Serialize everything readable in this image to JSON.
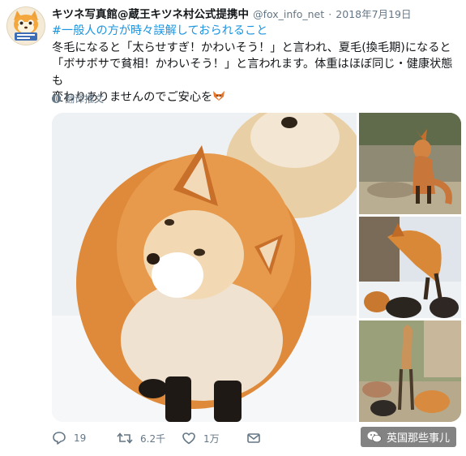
{
  "tweet": {
    "author": {
      "display_name": "キツネ写真館@蔵王キツネ村公式提携中",
      "handle": "@fox_info_net",
      "date": "2018年7月19日"
    },
    "separator": "·",
    "hashtag": "#一般人の方が時々誤解しておられること",
    "text_lines": [
      "冬毛になると「太らせすぎ！かわいそう！」と言われ、夏毛(換毛期)になると",
      "「ボサボサで貧相！かわいそう！」と言われます。体重はほぼ同じ・健康状態も",
      "変わりありませんのでご安心を"
    ],
    "emoji_icon": "fox-emoji",
    "translate_label": "翻译推文",
    "photos": [
      "winter-fox-photo",
      "summer-fox-photo",
      "jumping-fox-photo",
      "fox-group-photo"
    ],
    "actions": {
      "reply_count": "19",
      "retweet_count": "6.2千",
      "like_count": "1万"
    }
  },
  "watermark": {
    "label": "英国那些事儿",
    "icon": "wechat-icon"
  },
  "colors": {
    "link": "#1b95e0",
    "secondary": "#657786",
    "text": "#14171a",
    "fox_orange": "#e0822e"
  }
}
